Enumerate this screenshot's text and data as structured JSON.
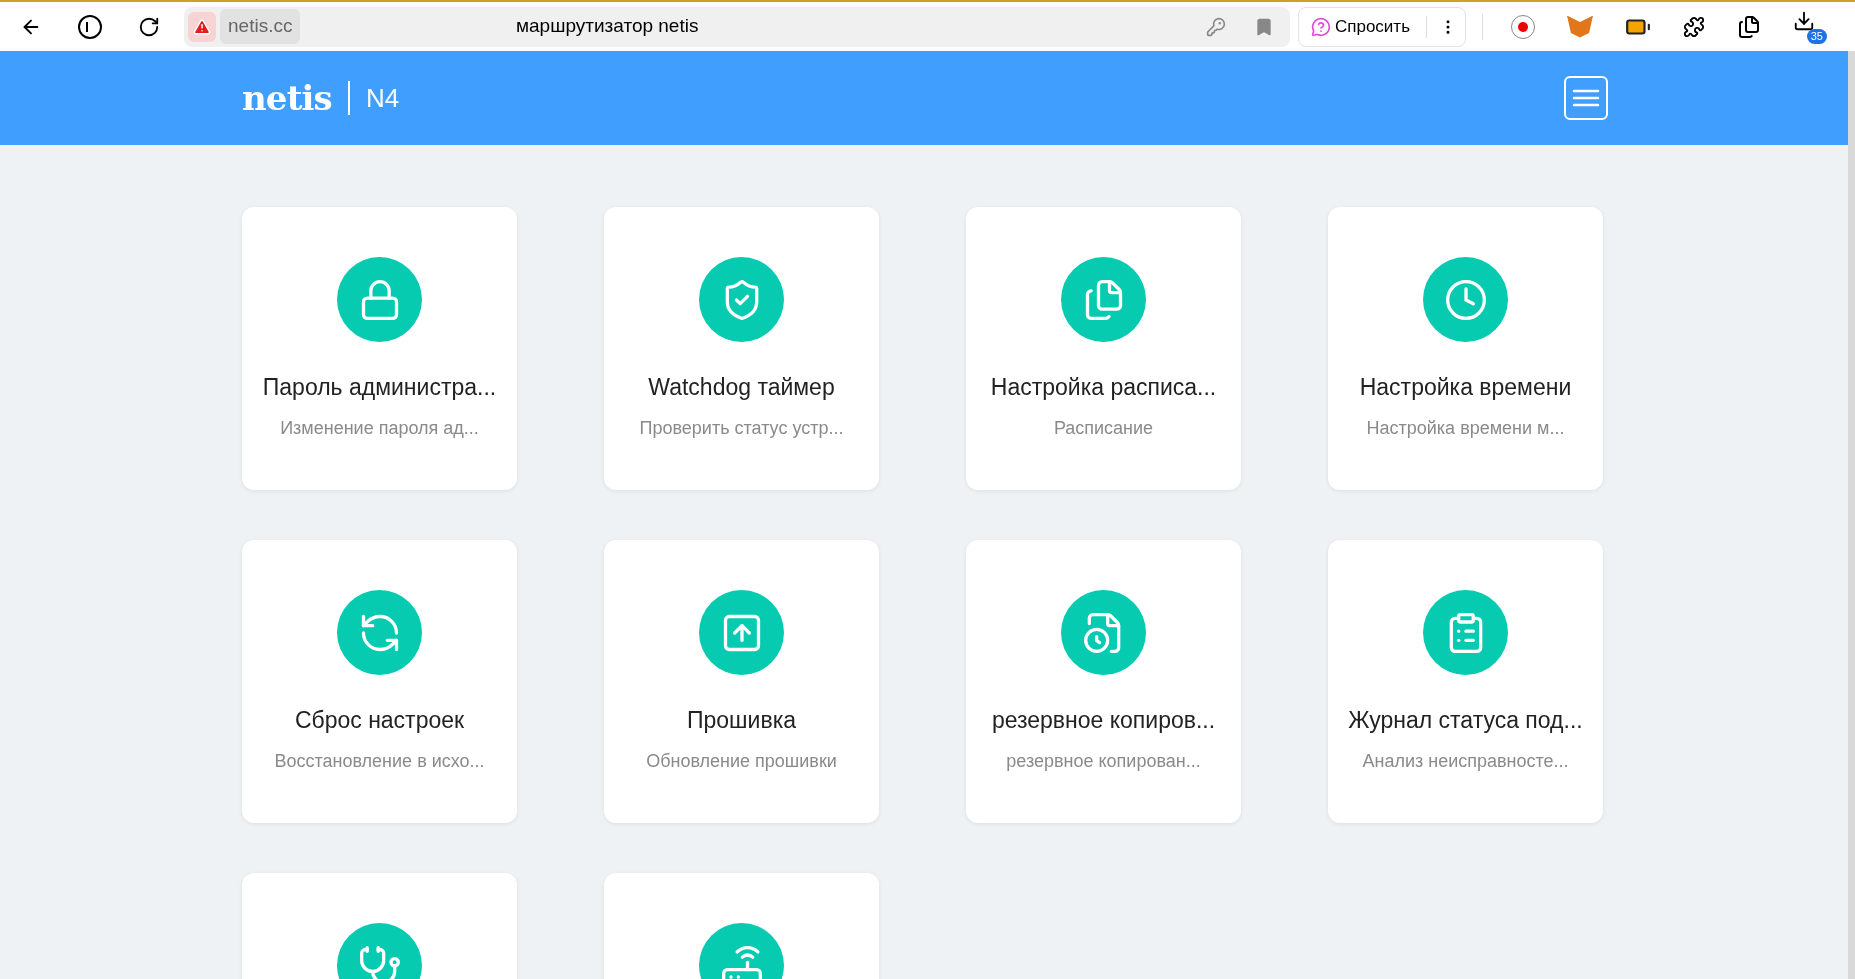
{
  "browser": {
    "url": "netis.cc",
    "title": "маршрутизатор netis",
    "ask_button": "Спросить",
    "badge": "35"
  },
  "header": {
    "logo": "netis",
    "model": "N4"
  },
  "cards": [
    {
      "kind": "lock",
      "title": "Пароль администра...",
      "subtitle": "Изменение пароля ад..."
    },
    {
      "kind": "shield",
      "title": "Watchdog таймер",
      "subtitle": "Проверить статус устр..."
    },
    {
      "kind": "files",
      "title": "Настройка расписа...",
      "subtitle": "Расписание"
    },
    {
      "kind": "clock",
      "title": "Настройка времени",
      "subtitle": "Настройка времени м..."
    },
    {
      "kind": "reset",
      "title": "Сброс настроек",
      "subtitle": "Восстановление в исхо..."
    },
    {
      "kind": "upload",
      "title": "Прошивка",
      "subtitle": "Обновление прошивки"
    },
    {
      "kind": "backup",
      "title": "резервное копиров...",
      "subtitle": "резервное копирован..."
    },
    {
      "kind": "clipboard",
      "title": "Журнал статуса под...",
      "subtitle": "Анализ неисправносте..."
    },
    {
      "kind": "stethoscope"
    },
    {
      "kind": "router"
    }
  ]
}
